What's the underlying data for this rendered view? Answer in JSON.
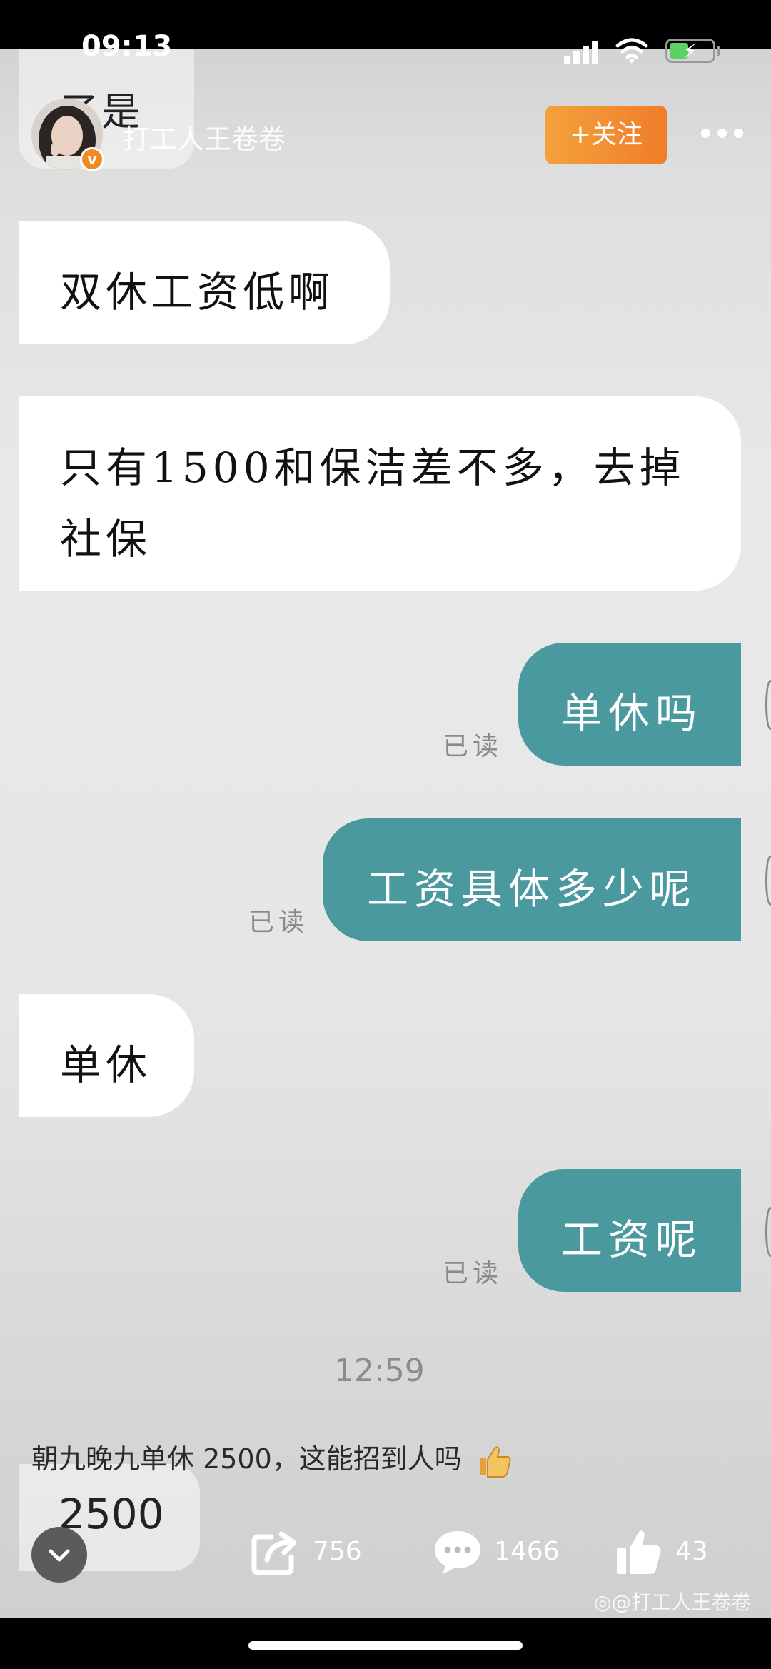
{
  "status_bar": {
    "time": "09:13"
  },
  "header": {
    "overlay_text": "了是",
    "username": "打工人王卷卷",
    "verified_mark": "v",
    "follow_label": "+关注"
  },
  "messages": [
    {
      "side": "left",
      "text": "双休工资低啊"
    },
    {
      "side": "left",
      "text": "只有1500和保洁差不多，去掉社保"
    },
    {
      "side": "right",
      "text": "单休吗",
      "read": "已读"
    },
    {
      "side": "right",
      "text": "工资具体多少呢",
      "read": "已读"
    },
    {
      "side": "left",
      "text": "单休"
    },
    {
      "side": "right",
      "text": "工资呢",
      "read": "已读"
    }
  ],
  "chat_time": "12:59",
  "post": {
    "caption": "朝九晚九单休 2500，这能招到人吗",
    "overlay_bubble_text": "2500",
    "share_count": "756",
    "comment_count": "1466",
    "like_count": "43",
    "watermark": "@打工人王卷卷"
  },
  "colors": {
    "sent_bubble": "#4a999f",
    "received_bubble": "#ffffff",
    "follow_button": "#f08a2c",
    "verified_badge": "#f08a24"
  },
  "icons": {
    "more": "more-dots-icon",
    "share": "share-icon",
    "comment": "comment-icon",
    "like": "thumbs-up-icon",
    "collapse": "chevron-down-icon"
  }
}
